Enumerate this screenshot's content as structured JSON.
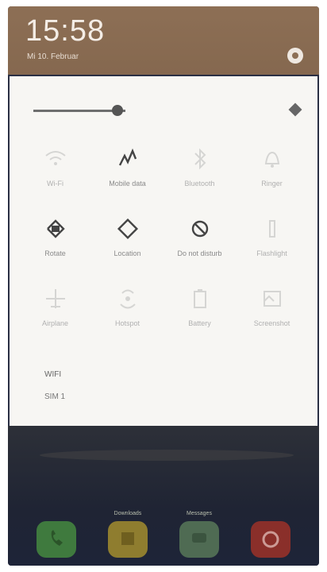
{
  "status": {
    "time": "15:58",
    "date": "Mi 10. Februar"
  },
  "brightness": {
    "level": 0.38
  },
  "tiles": [
    {
      "label": "Wi-Fi",
      "icon": "wifi-icon",
      "active": false
    },
    {
      "label": "Mobile data",
      "icon": "mobile-data-icon",
      "active": true
    },
    {
      "label": "Bluetooth",
      "icon": "bluetooth-icon",
      "active": false
    },
    {
      "label": "Ringer",
      "icon": "bell-icon",
      "active": false
    },
    {
      "label": "Rotate",
      "icon": "rotate-icon",
      "active": true
    },
    {
      "label": "Location",
      "icon": "location-icon",
      "active": true
    },
    {
      "label": "Do not disturb",
      "icon": "do-not-disturb-icon",
      "active": true
    },
    {
      "label": "Flashlight",
      "icon": "flashlight-icon",
      "active": false
    },
    {
      "label": "Airplane",
      "icon": "airplane-icon",
      "active": false
    },
    {
      "label": "Hotspot",
      "icon": "hotspot-icon",
      "active": false
    },
    {
      "label": "Battery",
      "icon": "battery-icon",
      "active": false
    },
    {
      "label": "Screenshot",
      "icon": "screenshot-icon",
      "active": false
    }
  ],
  "network": {
    "name": "WIFI",
    "sub": "SIM 1"
  },
  "dock": [
    {
      "label": "",
      "icon": "phone-icon",
      "color": "#3f7a3e"
    },
    {
      "label": "Downloads",
      "icon": "files-icon",
      "color": "#8f7d2f"
    },
    {
      "label": "Messages",
      "icon": "messages-icon",
      "color": "#4f6b53"
    },
    {
      "label": "",
      "icon": "browser-icon",
      "color": "#8a2f2a"
    }
  ]
}
